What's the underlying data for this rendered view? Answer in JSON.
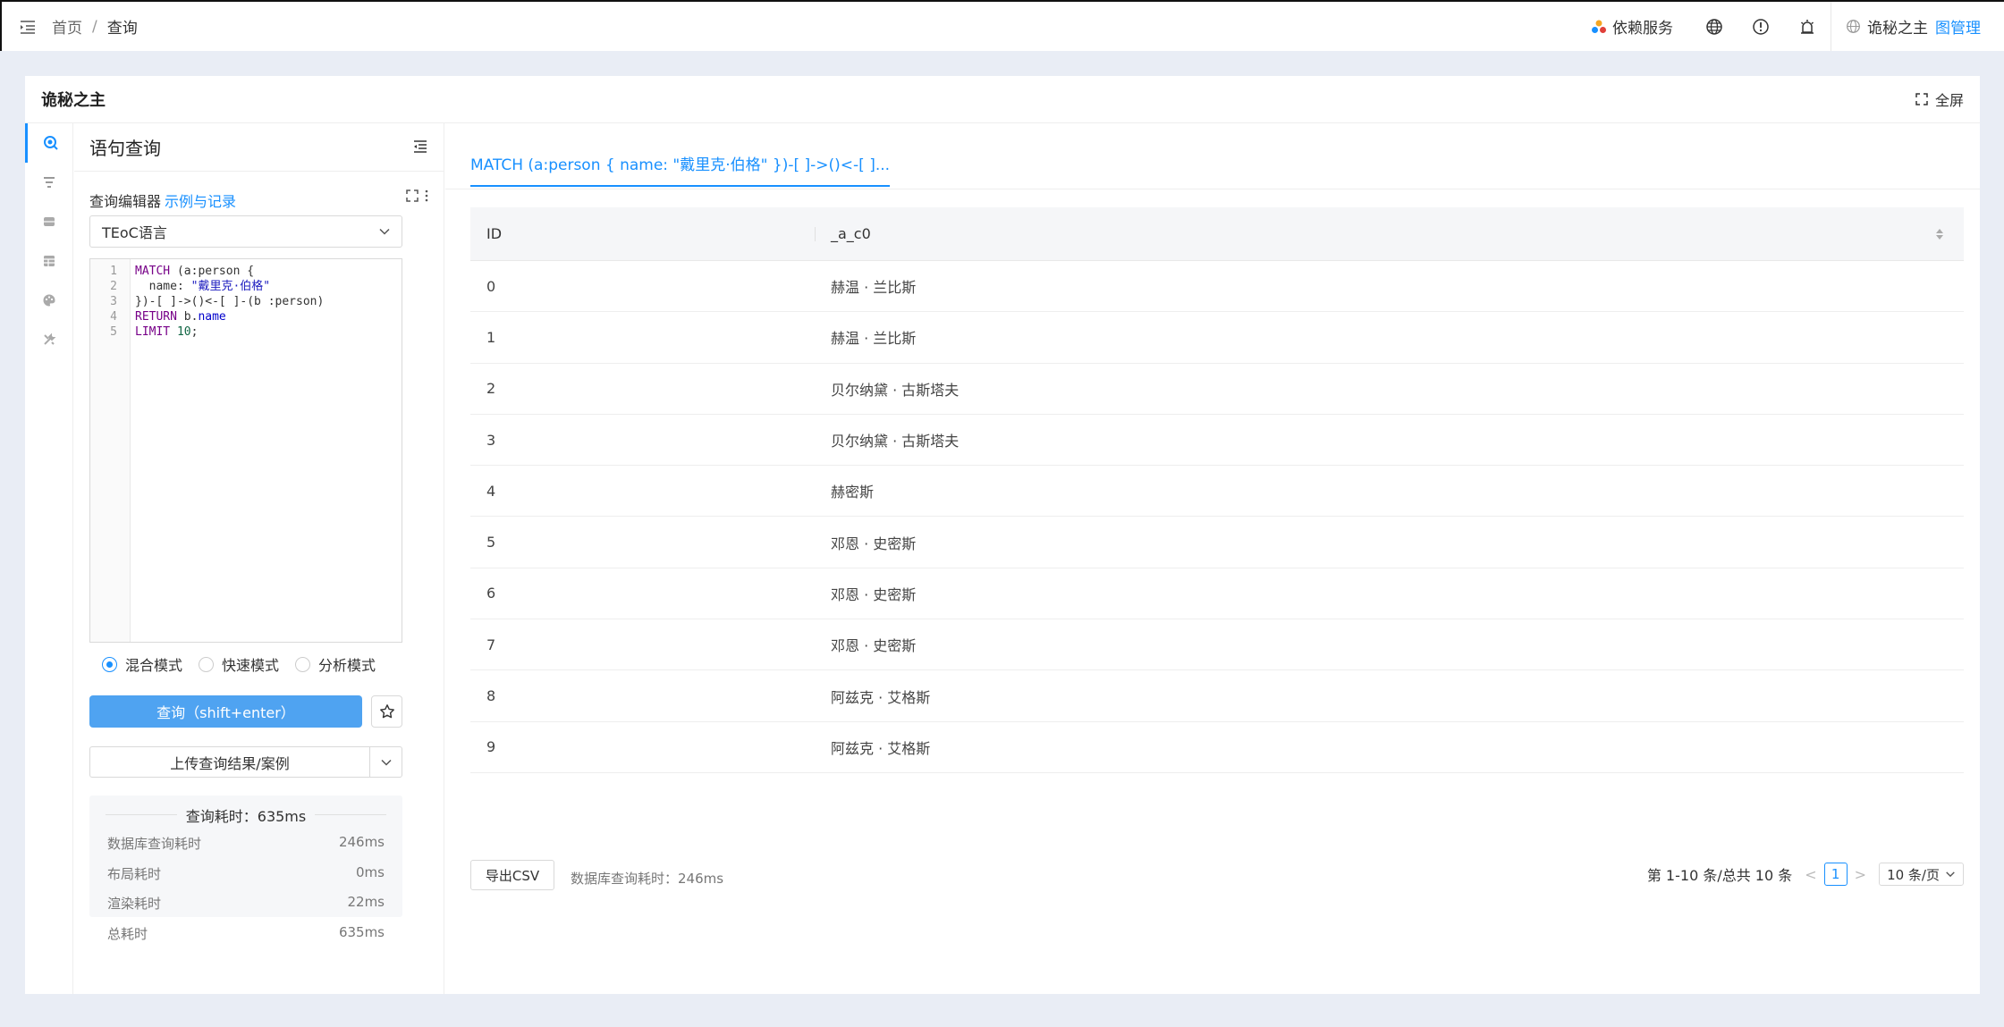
{
  "colors": {
    "accent": "#1890ff",
    "primary_button": "#4fa3f1",
    "background": "#e9edf5"
  },
  "topbar": {
    "breadcrumb": [
      "首页",
      "查询"
    ],
    "breadcrumb_sep": "/",
    "dependency_label": "依赖服务",
    "user_name": "诡秘之主",
    "graph_manage_link": "图管理"
  },
  "card": {
    "title": "诡秘之主",
    "fullscreen_label": "全屏"
  },
  "rail": {
    "icons": [
      "search-icon",
      "filter-icon",
      "database-icon",
      "table-icon",
      "palette-icon",
      "tools-icon"
    ]
  },
  "left_panel": {
    "title": "语句查询",
    "editor_label": "查询编辑器",
    "examples_link": "示例与记录",
    "language_select": "TEoC语言",
    "line_numbers": [
      "1",
      "2",
      "3",
      "4",
      "5"
    ],
    "code": {
      "l1_kw": "MATCH",
      "l1_rest": " (a:person {",
      "l2_key": "  name: ",
      "l2_str": "\"戴里克·伯格\"",
      "l3": "})-[ ]->()<-[ ]-(b :person)",
      "l4_kw": "RETURN",
      "l4_rest": " b.",
      "l4_prop": "name",
      "l5_kw": "LIMIT",
      "l5_num": " 10",
      "l5_end": ";"
    },
    "modes": [
      "混合模式",
      "快速模式",
      "分析模式"
    ],
    "selected_mode": "混合模式",
    "query_button": "查询（shift+enter）",
    "upload_button": "上传查询结果/案例",
    "stats": {
      "title": "查询耗时：635ms",
      "rows": [
        {
          "label": "数据库查询耗时",
          "value": "246ms"
        },
        {
          "label": "布局耗时",
          "value": "0ms"
        },
        {
          "label": "渲染耗时",
          "value": "22ms"
        },
        {
          "label": "总耗时",
          "value": "635ms"
        }
      ]
    }
  },
  "right_panel": {
    "tab_label": "MATCH (a:person { name: \"戴里克·伯格\" })-[ ]->()<-[ ]...",
    "table": {
      "columns": [
        "ID",
        "_a_c0"
      ],
      "rows": [
        [
          "0",
          "赫温 · 兰比斯"
        ],
        [
          "1",
          "赫温 · 兰比斯"
        ],
        [
          "2",
          "贝尔纳黛 · 古斯塔夫"
        ],
        [
          "3",
          "贝尔纳黛 · 古斯塔夫"
        ],
        [
          "4",
          "赫密斯"
        ],
        [
          "5",
          "邓恩 · 史密斯"
        ],
        [
          "6",
          "邓恩 · 史密斯"
        ],
        [
          "7",
          "邓恩 · 史密斯"
        ],
        [
          "8",
          "阿兹克 · 艾格斯"
        ],
        [
          "9",
          "阿兹克 · 艾格斯"
        ]
      ]
    },
    "export_button": "导出CSV",
    "db_time": "数据库查询耗时：246ms",
    "pagination": {
      "summary": "第 1-10 条/总共 10 条",
      "current_page": "1",
      "page_size": "10 条/页"
    }
  }
}
